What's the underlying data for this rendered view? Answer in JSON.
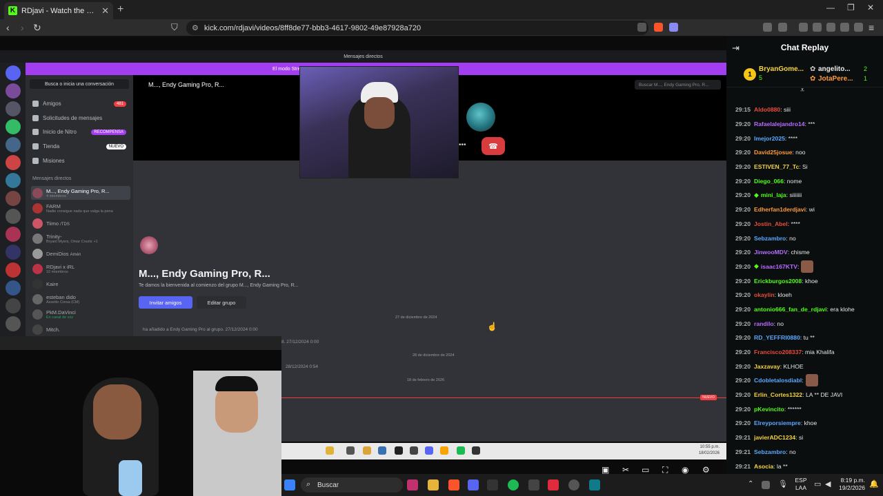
{
  "browser": {
    "tab_title": "RDjavi - Watch the VOD on K",
    "url": "kick.com/rdjavi/videos/8ff8de77-bbb3-4617-9802-49e87928a720"
  },
  "discord": {
    "window_title": "Mensajes directos",
    "banner_text": "El modo Stre",
    "banner_right": "litar",
    "search_placeholder": "Busca o inicia una conversación",
    "nav": [
      {
        "label": "Amigos",
        "pill": "481",
        "pill_color": "#f23f43"
      },
      {
        "label": "Solicitudes de mensajes",
        "pill": "",
        "pill_color": ""
      },
      {
        "label": "Inicio de Nitro",
        "pill": "RECOMPENSA",
        "pill_color": "#a33ef0"
      },
      {
        "label": "Tienda",
        "pill": "NUEVO",
        "pill_color": "#fff"
      },
      {
        "label": "Misiones",
        "pill": "",
        "pill_color": ""
      }
    ],
    "dm_header": "Mensajes directos",
    "dms": [
      {
        "name": "M..., Endy Gaming Pro, R...",
        "sub": "4 miembros"
      },
      {
        "name": "FARM",
        "sub": "Nadie consigue nada que valga la pena"
      },
      {
        "name": "Tiimo",
        "sub": "/TDS"
      },
      {
        "name": "Trinity-",
        "sub": "Bryant Myers, Omar Courtz +1"
      },
      {
        "name": "DemiDios",
        "sub": "Amén"
      },
      {
        "name": "RDjavi x iRL",
        "sub": "10 miembros"
      },
      {
        "name": "Kaire",
        "sub": ""
      },
      {
        "name": "esteban dido",
        "sub": "Assetto Corsa (CM)"
      },
      {
        "name": "PkM.DaVinci",
        "sub": "En canal de voz"
      },
      {
        "name": "Mitch.",
        "sub": ""
      }
    ],
    "channel_title": "M..., Endy Gaming Pro, R...",
    "channel_search": "Buscar M..., Endy Gaming Pro, R...",
    "group_name": "M..., Endy Gaming Pro, R...",
    "welcome": "Te damos la bienvenida al comienzo del grupo M..., Endy Gaming Pro, R...",
    "invite_btn": "Invitar amigos",
    "edit_btn": "Editar grupo",
    "dates": [
      "27 de diciembre de 2024",
      "28 de diciembre de 2024",
      "18 de febrero de 2026"
    ],
    "system_msg": "ha añadido a Endy Gaming Pro al grupo. 27/12/2024 0:00",
    "sys_msg2": "8. 27/12/2024 0:00",
    "sys_msg3": "28/12/2024 0:54",
    "new_label": "NUEVO",
    "mini_clock": "10:55 p.m.",
    "mini_date": "18/02/2026"
  },
  "taskbar": {
    "search_label": "Buscar",
    "lang1": "ESP",
    "lang2": "LAA",
    "time": "8:19 p.m.",
    "date": "19/2/2026"
  },
  "chat": {
    "title": "Chat Replay",
    "top_gifters": [
      {
        "rank": "1",
        "name": "BryanGome...",
        "count": "5"
      },
      {
        "name": "angelito...",
        "count": "2"
      },
      {
        "name": "JotaPere...",
        "count": "1"
      }
    ],
    "messages": [
      {
        "time": "29:15",
        "user": "Aldo0880",
        "color": "#e74c3c",
        "text": ": siii",
        "badge": "",
        "emote": ""
      },
      {
        "time": "29:20",
        "user": "Rafaelalejandro14",
        "color": "#b86bff",
        "text": ": ***",
        "badge": "",
        "emote": ""
      },
      {
        "time": "29:20",
        "user": "lmejor2025",
        "color": "#5aa9ff",
        "text": ": ****",
        "badge": "",
        "emote": ""
      },
      {
        "time": "29:20",
        "user": "David25josue",
        "color": "#ff9a3c",
        "text": ": noo",
        "badge": "",
        "emote": ""
      },
      {
        "time": "29:20",
        "user": "ESTIVEN_77_Tc",
        "color": "#f5d442",
        "text": ": Si",
        "badge": "",
        "emote": ""
      },
      {
        "time": "29:20",
        "user": "Diego_066",
        "color": "#53fc18",
        "text": ": nome",
        "badge": "",
        "emote": ""
      },
      {
        "time": "29:20",
        "user": "mini_laja",
        "color": "#53fc18",
        "text": ": siiiiiii",
        "badge": "◆",
        "emote": ""
      },
      {
        "time": "29:20",
        "user": "Edherfan1derdjavi",
        "color": "#ff9a3c",
        "text": ": wi",
        "badge": "",
        "emote": ""
      },
      {
        "time": "29:20",
        "user": "Jostin_Abel",
        "color": "#e74c3c",
        "text": ": ****",
        "badge": "",
        "emote": ""
      },
      {
        "time": "29:20",
        "user": "Sebzambro",
        "color": "#5aa9ff",
        "text": ": no",
        "badge": "",
        "emote": ""
      },
      {
        "time": "29:20",
        "user": "JinwooMDV",
        "color": "#b86bff",
        "text": ": chisme",
        "badge": "",
        "emote": ""
      },
      {
        "time": "29:20",
        "user": "isaac167KTV",
        "color": "#b86bff",
        "text": ":",
        "badge": "◆",
        "emote": "yes"
      },
      {
        "time": "29:20",
        "user": "Erickburgos2008",
        "color": "#53fc18",
        "text": ": khoe",
        "badge": "",
        "emote": ""
      },
      {
        "time": "29:20",
        "user": "okaylin",
        "color": "#e74c3c",
        "text": ": kloeh",
        "badge": "",
        "emote": ""
      },
      {
        "time": "29:20",
        "user": "antonio666_fan_de_rdjavi",
        "color": "#53fc18",
        "text": ": era klohe",
        "badge": "",
        "emote": ""
      },
      {
        "time": "29:20",
        "user": "randilo",
        "color": "#b86bff",
        "text": ": no",
        "badge": "",
        "emote": ""
      },
      {
        "time": "29:20",
        "user": "RD_YEFFRI0880",
        "color": "#5aa9ff",
        "text": ": tu **",
        "badge": "",
        "emote": ""
      },
      {
        "time": "29:20",
        "user": "Francisco208337",
        "color": "#e74c3c",
        "text": ": mia Khalifa",
        "badge": "",
        "emote": ""
      },
      {
        "time": "29:20",
        "user": "Jaxzavay",
        "color": "#f5d442",
        "text": ": KLHOE",
        "badge": "",
        "emote": ""
      },
      {
        "time": "29:20",
        "user": "Cdobletalosdiabl",
        "color": "#5aa9ff",
        "text": ":",
        "badge": "",
        "emote": "yes"
      },
      {
        "time": "29:20",
        "user": "Erlin_Cortes1322",
        "color": "#f5d442",
        "text": ": LA ** DE JAVI",
        "badge": "",
        "emote": ""
      },
      {
        "time": "29:20",
        "user": "pKevincito",
        "color": "#53fc18",
        "text": ": ******",
        "badge": "",
        "emote": ""
      },
      {
        "time": "29:20",
        "user": "Elreyporsiempre",
        "color": "#5aa9ff",
        "text": ": khoe",
        "badge": "",
        "emote": ""
      },
      {
        "time": "29:21",
        "user": "javierADC1234",
        "color": "#f5d442",
        "text": ": si",
        "badge": "",
        "emote": ""
      },
      {
        "time": "29:21",
        "user": "Sebzambro",
        "color": "#5aa9ff",
        "text": ": no",
        "badge": "",
        "emote": ""
      },
      {
        "time": "29:21",
        "user": "Asocia",
        "color": "#f5d442",
        "text": ": la **",
        "badge": "",
        "emote": ""
      }
    ]
  }
}
